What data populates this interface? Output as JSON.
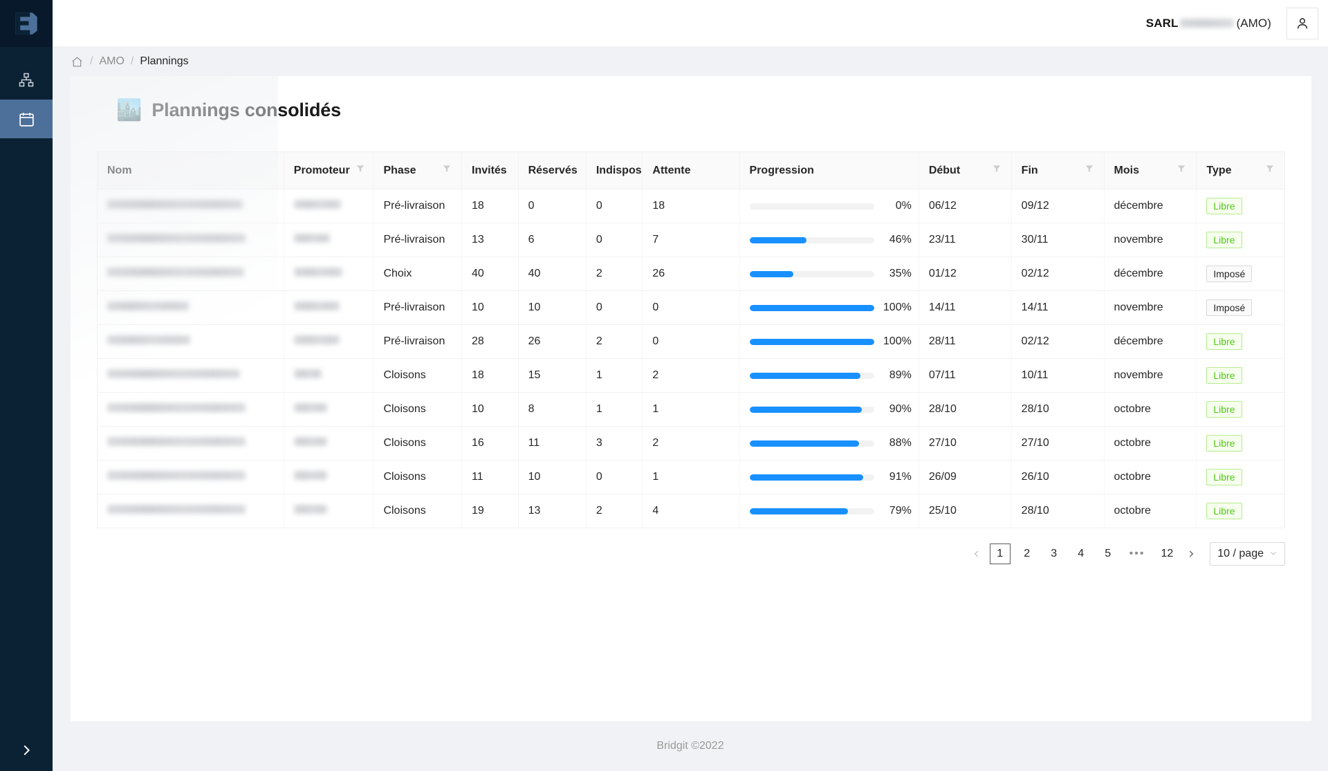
{
  "app": {
    "logo_name": "bridgit-logo",
    "footer": "Bridgit ©2022"
  },
  "sidebar": {
    "items": [
      {
        "name": "sidebar-item-organisation",
        "icon": "sitemap-icon",
        "active": false
      },
      {
        "name": "sidebar-item-plannings",
        "icon": "calendar-icon",
        "active": true
      }
    ],
    "expand_label": "",
    "expand_icon": "chevron-right-icon",
    "active_color": "#4d709a",
    "background": "#0b2134"
  },
  "topbar": {
    "account_prefix": "SARL",
    "account_redacted": true,
    "account_suffix": "(AMO)",
    "avatar_icon": "user-icon"
  },
  "breadcrumb": {
    "home_icon": "home-icon",
    "separator": "/",
    "items": [
      {
        "label": "AMO",
        "current": false
      },
      {
        "label": "Plannings",
        "current": true
      }
    ]
  },
  "page": {
    "emoji": "🏙️",
    "emoji_name": "cityscape-emoji",
    "title": "Plannings consolidés"
  },
  "table": {
    "columns": [
      {
        "key": "nom",
        "label": "Nom",
        "filter": false
      },
      {
        "key": "promoteur",
        "label": "Promoteur",
        "filter": true
      },
      {
        "key": "phase",
        "label": "Phase",
        "filter": true
      },
      {
        "key": "invites",
        "label": "Invités",
        "filter": false
      },
      {
        "key": "reserves",
        "label": "Réservés",
        "filter": false
      },
      {
        "key": "indispos",
        "label": "Indispos",
        "filter": false
      },
      {
        "key": "attente",
        "label": "Attente",
        "filter": false
      },
      {
        "key": "progression",
        "label": "Progression",
        "filter": false
      },
      {
        "key": "debut",
        "label": "Début",
        "filter": true
      },
      {
        "key": "fin",
        "label": "Fin",
        "filter": true
      },
      {
        "key": "mois",
        "label": "Mois",
        "filter": true
      },
      {
        "key": "type",
        "label": "Type",
        "filter": true
      }
    ],
    "rows": [
      {
        "nom": "",
        "nom_redacted_width": 196,
        "promoteur": "",
        "promoteur_redacted_width": 68,
        "phase": "Pré-livraison",
        "invites": "18",
        "reserves": "0",
        "indispos": "0",
        "attente": "18",
        "progression": 0,
        "progression_label": "0%",
        "debut": "06/12",
        "fin": "09/12",
        "mois": "décembre",
        "type": "Libre",
        "type_style": "libre"
      },
      {
        "nom": "",
        "nom_redacted_width": 200,
        "promoteur": "",
        "promoteur_redacted_width": 52,
        "phase": "Pré-livraison",
        "invites": "13",
        "reserves": "6",
        "indispos": "0",
        "attente": "7",
        "progression": 46,
        "progression_label": "46%",
        "debut": "23/11",
        "fin": "30/11",
        "mois": "novembre",
        "type": "Libre",
        "type_style": "libre"
      },
      {
        "nom": "",
        "nom_redacted_width": 198,
        "promoteur": "",
        "promoteur_redacted_width": 70,
        "phase": "Choix",
        "invites": "40",
        "reserves": "40",
        "indispos": "2",
        "attente": "26",
        "progression": 35,
        "progression_label": "35%",
        "debut": "01/12",
        "fin": "02/12",
        "mois": "décembre",
        "type": "Imposé",
        "type_style": "impose"
      },
      {
        "nom": "",
        "nom_redacted_width": 118,
        "promoteur": "",
        "promoteur_redacted_width": 66,
        "phase": "Pré-livraison",
        "invites": "10",
        "reserves": "10",
        "indispos": "0",
        "attente": "0",
        "progression": 100,
        "progression_label": "100%",
        "debut": "14/11",
        "fin": "14/11",
        "mois": "novembre",
        "type": "Imposé",
        "type_style": "impose"
      },
      {
        "nom": "",
        "nom_redacted_width": 120,
        "promoteur": "",
        "promoteur_redacted_width": 66,
        "phase": "Pré-livraison",
        "invites": "28",
        "reserves": "26",
        "indispos": "2",
        "attente": "0",
        "progression": 100,
        "progression_label": "100%",
        "debut": "28/11",
        "fin": "02/12",
        "mois": "décembre",
        "type": "Libre",
        "type_style": "libre"
      },
      {
        "nom": "",
        "nom_redacted_width": 192,
        "promoteur": "",
        "promoteur_redacted_width": 40,
        "phase": "Cloisons",
        "invites": "18",
        "reserves": "15",
        "indispos": "1",
        "attente": "2",
        "progression": 89,
        "progression_label": "89%",
        "debut": "07/11",
        "fin": "10/11",
        "mois": "novembre",
        "type": "Libre",
        "type_style": "libre"
      },
      {
        "nom": "",
        "nom_redacted_width": 200,
        "promoteur": "",
        "promoteur_redacted_width": 48,
        "phase": "Cloisons",
        "invites": "10",
        "reserves": "8",
        "indispos": "1",
        "attente": "1",
        "progression": 90,
        "progression_label": "90%",
        "debut": "28/10",
        "fin": "28/10",
        "mois": "octobre",
        "type": "Libre",
        "type_style": "libre"
      },
      {
        "nom": "",
        "nom_redacted_width": 200,
        "promoteur": "",
        "promoteur_redacted_width": 48,
        "phase": "Cloisons",
        "invites": "16",
        "reserves": "11",
        "indispos": "3",
        "attente": "2",
        "progression": 88,
        "progression_label": "88%",
        "debut": "27/10",
        "fin": "27/10",
        "mois": "octobre",
        "type": "Libre",
        "type_style": "libre"
      },
      {
        "nom": "",
        "nom_redacted_width": 200,
        "promoteur": "",
        "promoteur_redacted_width": 48,
        "phase": "Cloisons",
        "invites": "11",
        "reserves": "10",
        "indispos": "0",
        "attente": "1",
        "progression": 91,
        "progression_label": "91%",
        "debut": "26/09",
        "fin": "26/10",
        "mois": "octobre",
        "type": "Libre",
        "type_style": "libre"
      },
      {
        "nom": "",
        "nom_redacted_width": 200,
        "promoteur": "",
        "promoteur_redacted_width": 48,
        "phase": "Cloisons",
        "invites": "19",
        "reserves": "13",
        "indispos": "2",
        "attente": "4",
        "progression": 79,
        "progression_label": "79%",
        "debut": "25/10",
        "fin": "28/10",
        "mois": "octobre",
        "type": "Libre",
        "type_style": "libre"
      }
    ]
  },
  "pagination": {
    "prev_icon": "chevron-left-icon",
    "next_icon": "chevron-right-icon",
    "pages": [
      "1",
      "2",
      "3",
      "4",
      "5"
    ],
    "ellipsis": "•••",
    "last_page": "12",
    "active_page": "1",
    "page_size_label": "10 / page",
    "page_size_caret": "chevron-down-icon"
  },
  "colors": {
    "progress_fill": "#1890ff",
    "tag_libre_text": "#52c41a",
    "tag_libre_bg": "#f6ffed",
    "tag_libre_border": "#b7eb8f",
    "sidebar_bg": "#0b2134",
    "sidebar_active": "#4d709a",
    "page_bg": "#f0f2f5"
  }
}
